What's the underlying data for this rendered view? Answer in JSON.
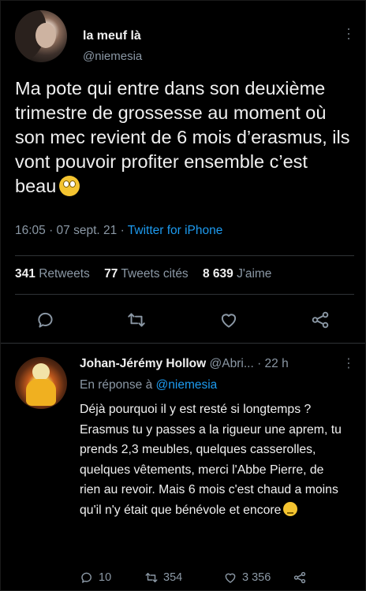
{
  "tweet": {
    "author_name": "la meuf là",
    "author_handle": "@niemesia",
    "text": "Ma pote qui entre dans son deuxième trimestre de grossesse au moment où son mec revient de 6 mois d’erasmus, ils vont pouvoir profiter ensemble c’est beau",
    "time": "16:05 · 07 sept. 21 ·",
    "source": "Twitter for iPhone",
    "retweets_count": "341",
    "retweets_label": "Retweets",
    "quotes_count": "77",
    "quotes_label": "Tweets cités",
    "likes_count": "8 639",
    "likes_label": "J'aime",
    "icons": [
      "reply-icon",
      "retweet-icon",
      "like-icon",
      "share-icon",
      "more-icon"
    ]
  },
  "reply": {
    "author_name": "Johan-Jérémy Hollow",
    "author_handle": "@Abri...",
    "time": "· 22 h",
    "replying_to_prefix": "En réponse à",
    "replying_to_handle": "@niemesia",
    "text": "Déjà pourquoi il y est resté si longtemps ? Erasmus tu y passes a la rigueur une aprem, tu prends 2,3 meubles, quelques casserolles, quelques vêtements, merci l'Abbe Pierre, de rien au revoir. Mais 6 mois c'est chaud a moins qu'il n'y était que bénévole et encore",
    "reply_count": "10",
    "retweet_count": "354",
    "like_count": "3 356"
  },
  "colors": {
    "background": "#000000",
    "text": "#f0f0f0",
    "muted": "#8b98a5",
    "link": "#1d9bf0",
    "divider": "#2f3336"
  }
}
